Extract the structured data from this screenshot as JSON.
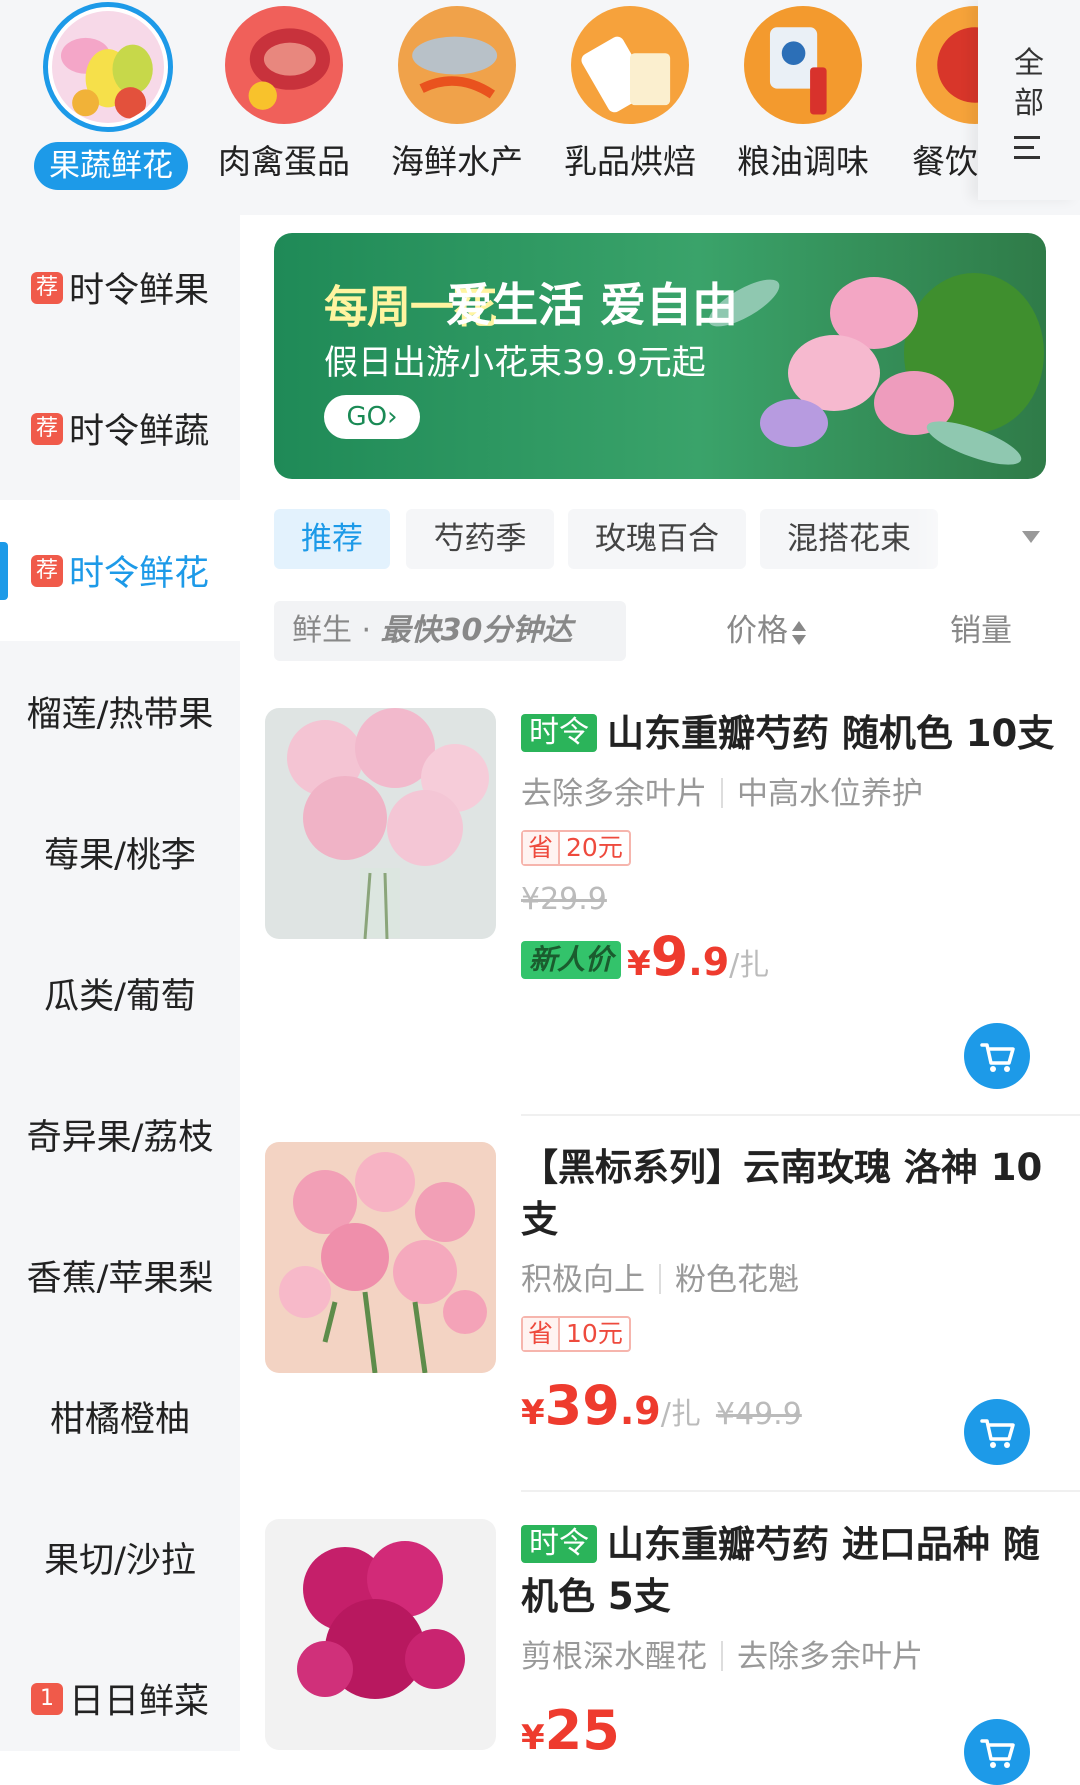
{
  "top_categories": [
    {
      "label": "果蔬鲜花",
      "selected": true
    },
    {
      "label": "肉禽蛋品",
      "selected": false
    },
    {
      "label": "海鲜水产",
      "selected": false
    },
    {
      "label": "乳品烘焙",
      "selected": false
    },
    {
      "label": "粮油调味",
      "selected": false
    },
    {
      "label": "餐饮",
      "selected": false
    }
  ],
  "all_button": {
    "line1": "全",
    "line2": "部",
    "icon": "menu-icon"
  },
  "sidebar": {
    "items": [
      {
        "label": "时令鲜果",
        "badge": "荐"
      },
      {
        "label": "时令鲜蔬",
        "badge": "荐"
      },
      {
        "label": "时令鲜花",
        "badge": "荐",
        "active": true
      },
      {
        "label": "榴莲/热带果"
      },
      {
        "label": "莓果/桃李"
      },
      {
        "label": "瓜类/葡萄"
      },
      {
        "label": "奇异果/荔枝"
      },
      {
        "label": "香蕉/苹果梨"
      },
      {
        "label": "柑橘橙柚"
      },
      {
        "label": "果切/沙拉"
      },
      {
        "label": "日日鲜菜",
        "badge": "1"
      }
    ]
  },
  "banner": {
    "brand": "每周一花",
    "title": "爱生活 爱自由",
    "subtitle": "假日出游小花束39.9元起",
    "cta": "GO›"
  },
  "chips": [
    {
      "label": "推荐",
      "active": true
    },
    {
      "label": "芍药季"
    },
    {
      "label": "玫瑰百合"
    },
    {
      "label": "混搭花束"
    }
  ],
  "sortbar": {
    "fresh_label": "鲜生 · ",
    "fresh_fast": "最快30分钟达",
    "price_label": "价格",
    "sales_label": "销量"
  },
  "products": [
    {
      "tag": "时令",
      "title": "山东重瓣芍药 随机色 10支",
      "desc1": "去除多余叶片",
      "desc2": "中高水位养护",
      "save_prefix": "省",
      "save_amount": "20元",
      "original_price": "¥29.9",
      "newbie_label": "新人价",
      "price_currency": "¥",
      "price_int": "9",
      "price_dec": ".9",
      "unit": "/扎"
    },
    {
      "tag": "",
      "title": "【黑标系列】云南玫瑰 洛神 10支",
      "desc1": "积极向上",
      "desc2": "粉色花魁",
      "save_prefix": "省",
      "save_amount": "10元",
      "original_price": "¥49.9",
      "price_currency": "¥",
      "price_int": "39",
      "price_dec": ".9",
      "unit": "/扎"
    },
    {
      "tag": "时令",
      "title": "山东重瓣芍药 进口品种 随机色 5支",
      "desc1": "剪根深水醒花",
      "desc2": "去除多余叶片",
      "price_currency": "¥",
      "price_int": "25"
    }
  ],
  "colors": {
    "accent": "#1d9ae8",
    "price_red": "#ee3b2e",
    "season_green": "#2bb45a",
    "badge_red": "#f05a4a"
  }
}
